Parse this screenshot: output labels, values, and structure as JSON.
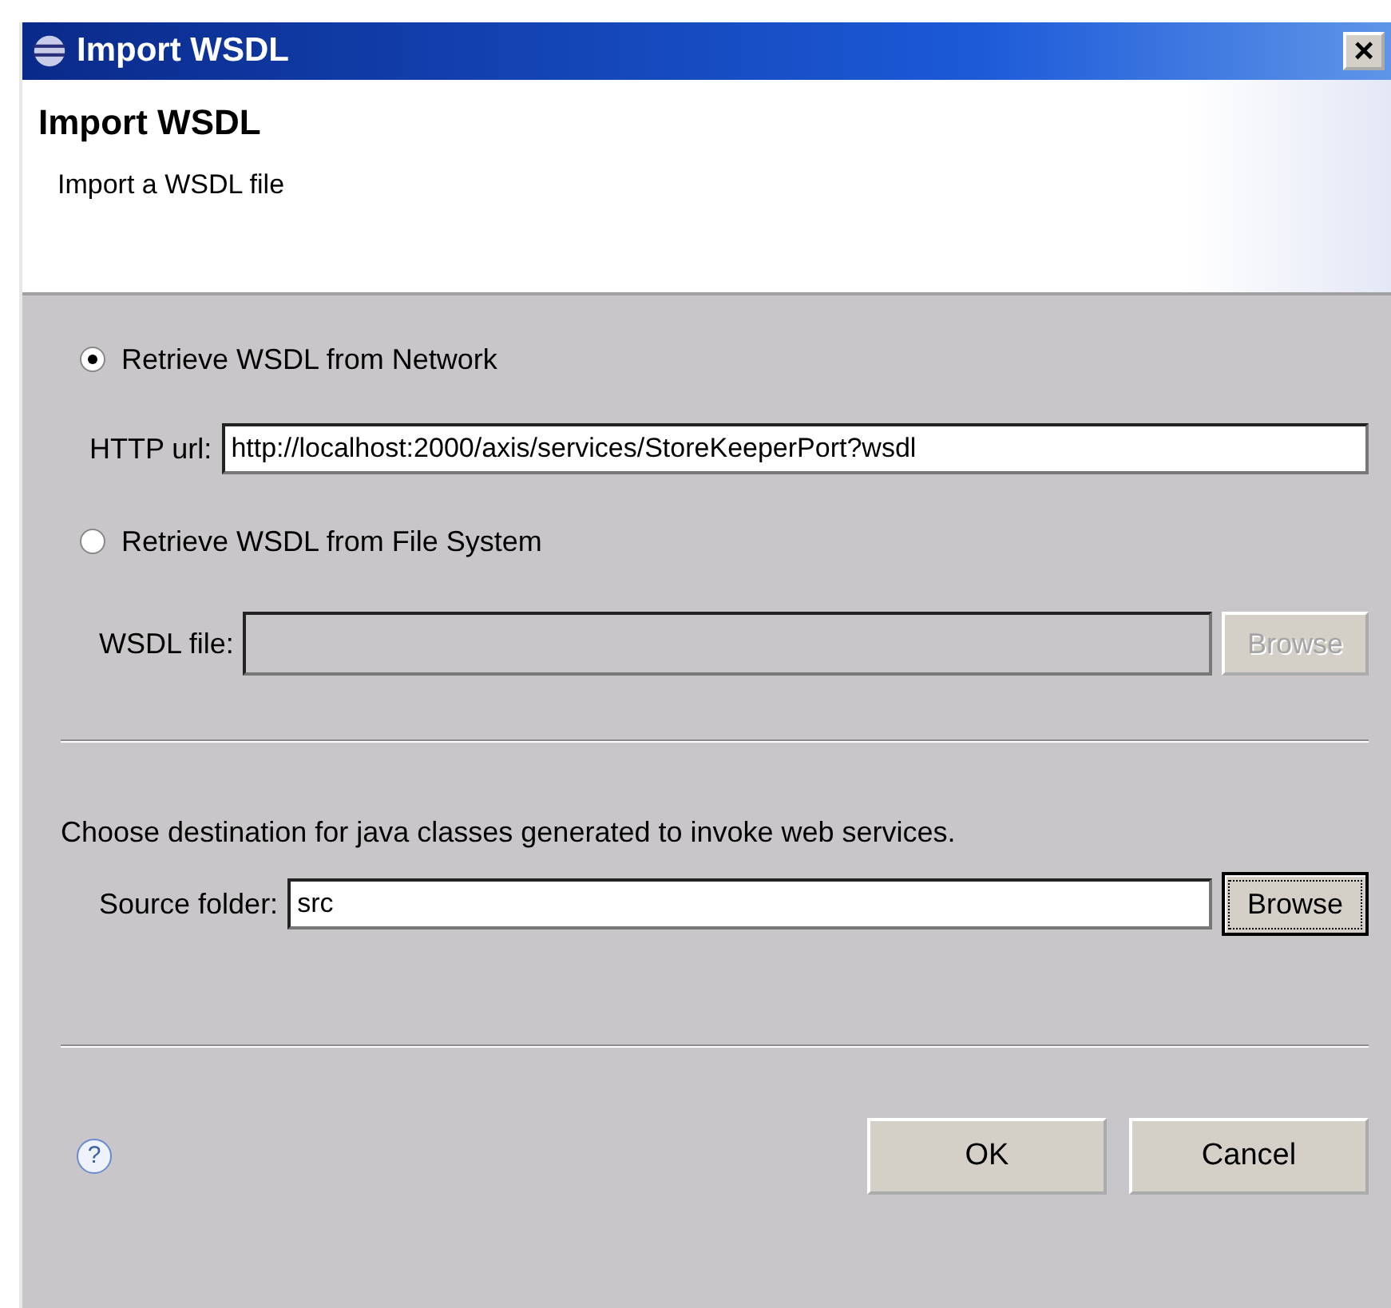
{
  "window": {
    "title": "Import WSDL",
    "close": "×"
  },
  "header": {
    "title": "Import WSDL",
    "description": "Import a WSDL file"
  },
  "sources": [
    {
      "label": "Retrieve WSDL from Network",
      "selected": true,
      "field_label": "HTTP url:",
      "value": "http://localhost:2000/axis/services/StoreKeeperPort?wsdl",
      "disabled": false
    },
    {
      "label": "Retrieve WSDL from File System",
      "selected": false,
      "field_label": "WSDL file:",
      "disabled": true,
      "button": "Browse"
    }
  ],
  "destination": {
    "instruction": "Choose destination for java classes generated to invoke web services.",
    "field_label": "Source folder:",
    "value": "src",
    "button": "Browse",
    "focused": true
  },
  "help": "?",
  "buttons": [
    "OK",
    "Cancel"
  ]
}
